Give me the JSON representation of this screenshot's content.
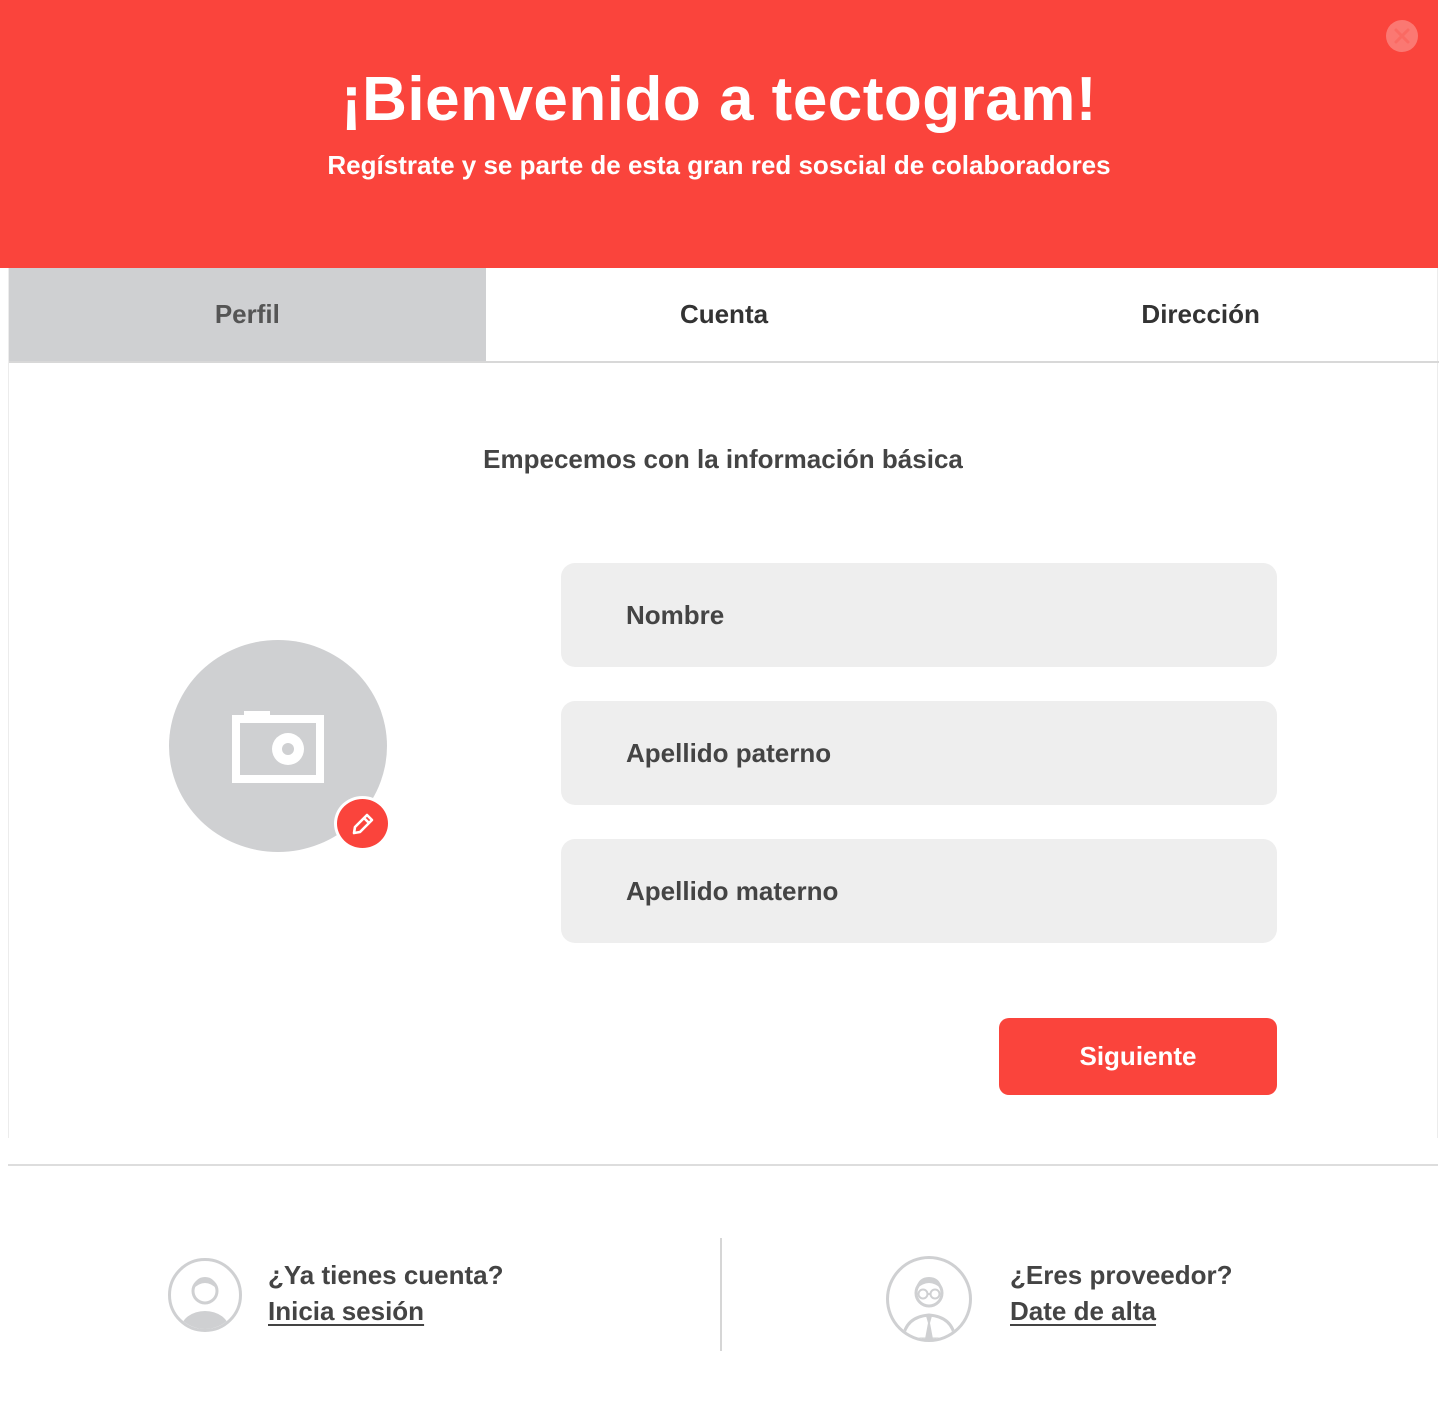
{
  "header": {
    "title": "¡Bienvenido a tectogram!",
    "subtitle": "Regístrate y se parte de esta gran red soscial de colaboradores",
    "close_icon": "close-icon"
  },
  "tabs": [
    {
      "label": "Perfil",
      "active": true
    },
    {
      "label": "Cuenta",
      "active": false
    },
    {
      "label": "Dirección",
      "active": false
    }
  ],
  "form": {
    "intro": "Empecemos con la información básica",
    "avatar_icon": "camera-icon",
    "edit_icon": "pencil-icon",
    "fields": [
      {
        "placeholder": "Nombre",
        "value": ""
      },
      {
        "placeholder": "Apellido paterno",
        "value": ""
      },
      {
        "placeholder": "Apellido materno",
        "value": ""
      }
    ],
    "next_label": "Siguiente"
  },
  "footer": {
    "login": {
      "question": "¿Ya tienes cuenta?",
      "link": "Inicia sesión",
      "icon": "user-icon"
    },
    "provider": {
      "question": "¿Eres proveedor?",
      "link": "Date de alta",
      "icon": "provider-icon"
    }
  },
  "colors": {
    "accent": "#fa443c",
    "tab_active": "#cfd0d2",
    "field_bg": "#eeeeee"
  }
}
